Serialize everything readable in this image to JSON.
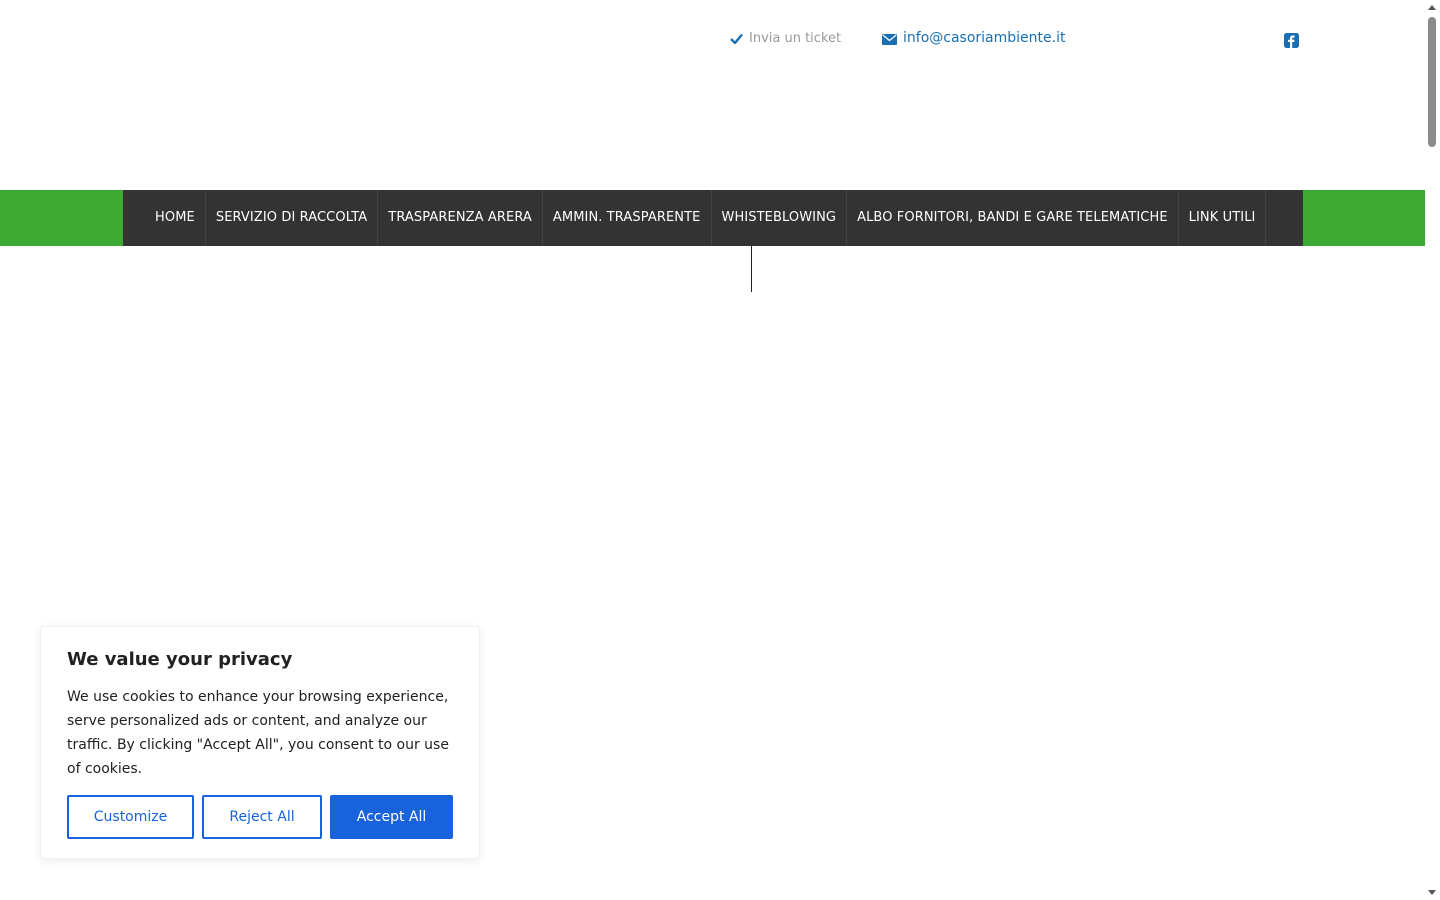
{
  "header": {
    "ticket_label": "Invia un ticket",
    "email_label": "info@casoriambiente.it",
    "icons": {
      "ticket": "check-icon",
      "email": "envelope-icon",
      "social": "facebook-icon"
    }
  },
  "nav": {
    "items": [
      {
        "label": "HOME"
      },
      {
        "label": "SERVIZIO DI RACCOLTA"
      },
      {
        "label": "TRASPARENZA ARERA"
      },
      {
        "label": "AMMIN. TRASPARENTE"
      },
      {
        "label": "WHISTEBLOWING"
      },
      {
        "label": "ALBO FORNITORI, BANDI E GARE TELEMATICHE"
      },
      {
        "label": "LINK UTILI"
      }
    ]
  },
  "cookie_banner": {
    "title": "We value your privacy",
    "text": "We use cookies to enhance your browsing experience, serve personalized ads or content, and analyze our traffic. By clicking \"Accept All\", you consent to our use of cookies.",
    "customize_label": "Customize",
    "reject_label": "Reject All",
    "accept_label": "Accept All"
  },
  "colors": {
    "nav_band": "#3faa33",
    "nav_bg": "#333333",
    "link_blue": "#1a6fb3",
    "button_blue": "#1863dc"
  }
}
